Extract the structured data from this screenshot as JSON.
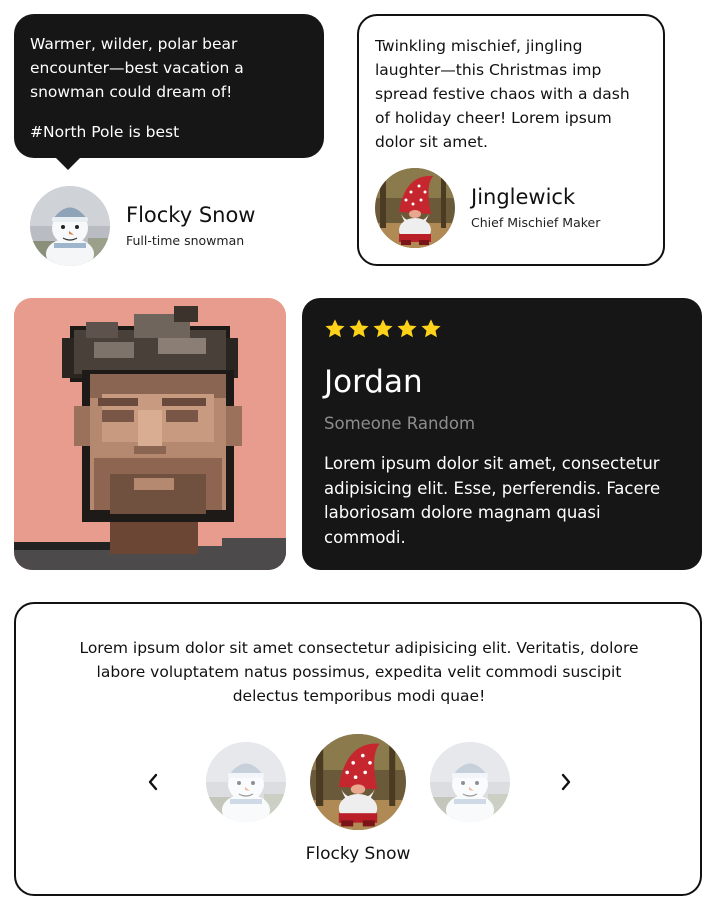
{
  "card_bubble": {
    "quote_line1": "Warmer, wilder, polar bear encounter—best vacation a snowman could dream of!",
    "quote_line2": "#North Pole is best",
    "author": {
      "name": "Flocky Snow",
      "role": "Full-time snowman",
      "avatar": "snowman-avatar"
    }
  },
  "card_outline": {
    "quote": "Twinkling mischief, jingling laughter—this Christmas imp spread festive chaos with a dash of holiday cheer! Lorem ipsum dolor sit amet.",
    "author": {
      "name": "Jinglewick",
      "role": "Chief Mischief Maker",
      "avatar": "gnome-avatar"
    }
  },
  "card_dark": {
    "rating": 5,
    "rating_max": 5,
    "name": "Jordan",
    "subtitle": "Someone Random",
    "quote": "Lorem ipsum dolor sit amet, consectetur adipisicing elit. Esse, perferendis. Facere laboriosam dolore magnam quasi commodi.",
    "portrait": "pixel-art-portrait"
  },
  "carousel": {
    "quote": "Lorem ipsum dolor sit amet consectetur adipisicing elit. Veritatis, dolore labore voluptatem natus possimus, expedita velit commodi suscipit delectus temporibus modi quae!",
    "prev_icon": "chevron-left-icon",
    "next_icon": "chevron-right-icon",
    "avatars": [
      "snowman-avatar",
      "gnome-avatar",
      "snowman-avatar"
    ],
    "active_index": 1,
    "active_name": "Flocky Snow"
  },
  "colors": {
    "dark": "#161616",
    "star": "#ffd21a",
    "muted": "#8d8d8d",
    "portrait_bg": "#e79c8e"
  }
}
